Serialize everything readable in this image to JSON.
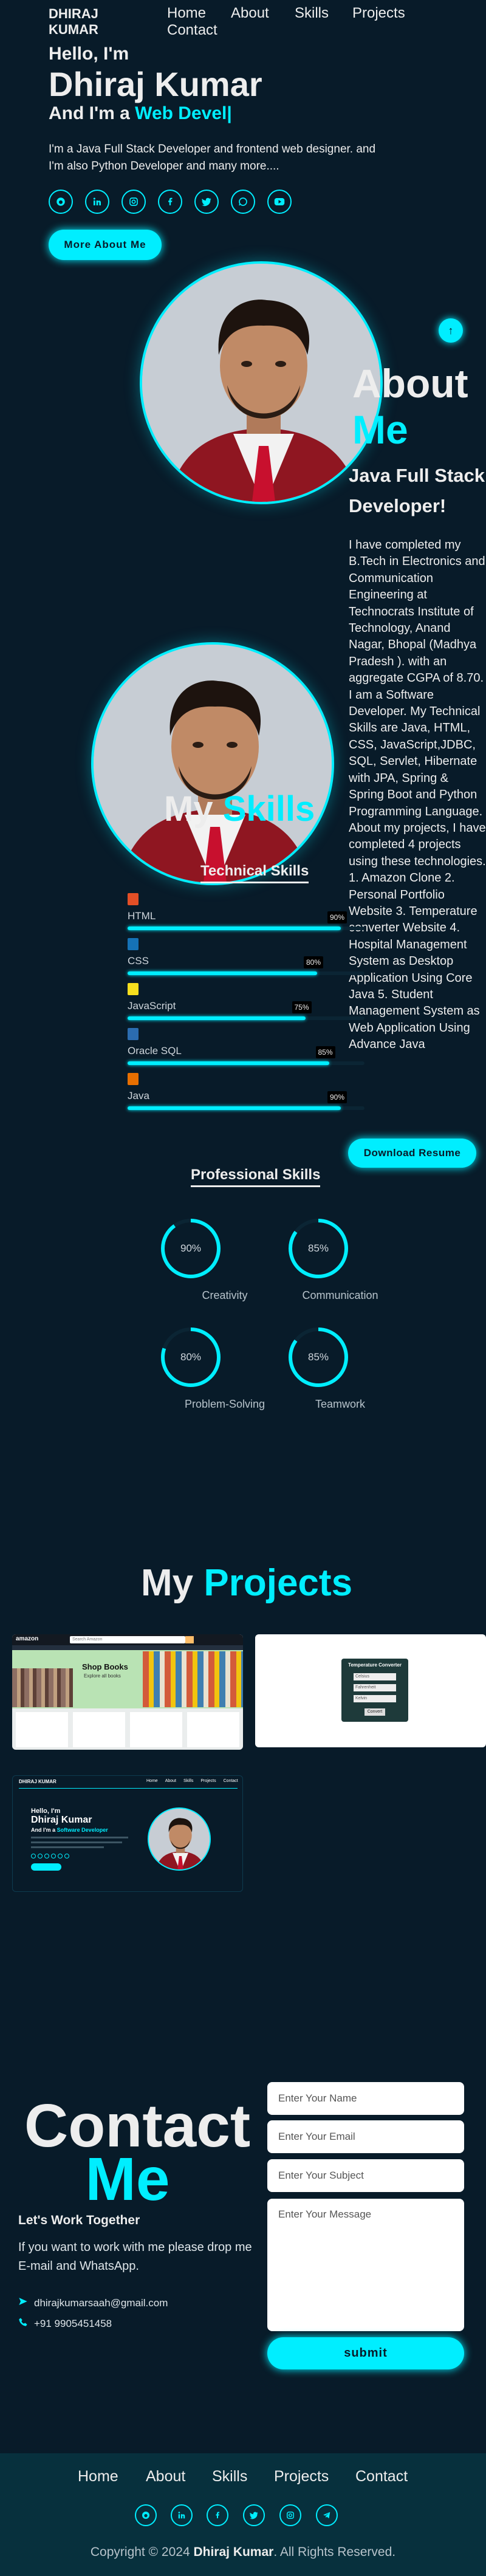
{
  "header": {
    "logo": "DHIRAJ KUMAR",
    "nav": [
      "Home",
      "About",
      "Skills",
      "Projects",
      "Contact"
    ]
  },
  "home": {
    "greeting": "Hello, I'm",
    "name": "Dhiraj Kumar",
    "iam_prefix": "And I'm a",
    "typed_role": "Web Devel|",
    "intro": "I'm a Java Full Stack Developer and frontend web designer. and I'm also Python Developer and many more....",
    "social_icons": [
      "github-icon",
      "linkedin-icon",
      "instagram-icon",
      "facebook-icon",
      "twitter-icon",
      "whatsapp-icon",
      "youtube-icon"
    ],
    "more_button": "More About Me",
    "scroll_top": "↑"
  },
  "about": {
    "title_1": "About",
    "title_2": "Me",
    "subtitle": "Java Full Stack Developer!",
    "text": "I have completed my B.Tech in Electronics and Communication Engineering at Technocrats Institute of Technology, Anand Nagar, Bhopal (Madhya Pradesh ). with an aggregate CGPA of 8.70. I am a Software Developer. My Technical Skills are Java, HTML, CSS, JavaScript,JDBC, SQL, Servlet, Hibernate with JPA, Spring & Spring Boot and Python Programming Language. About my projects, I have completed 4 projects using these technologies. 1. Amazon Clone 2. Personal Portfolio Website 3. Temperature converter Website 4. Hospital Management System as Desktop Application Using Core Java 5. Student Management System as Web Application Using Advance Java",
    "download_button": "Download Resume"
  },
  "skills": {
    "title_1": "My",
    "title_2": "Skills",
    "technical_title": "Technical Skills",
    "technical": [
      {
        "name": "HTML",
        "percent": 90,
        "label": "90%",
        "icon": "html5-icon",
        "color": "#e34f26"
      },
      {
        "name": "CSS",
        "percent": 80,
        "label": "80%",
        "icon": "css3-icon",
        "color": "#1572b6"
      },
      {
        "name": "JavaScript",
        "percent": 75,
        "label": "75%",
        "icon": "javascript-icon",
        "color": "#f7df1e"
      },
      {
        "name": "Oracle SQL",
        "percent": 85,
        "label": "85%",
        "icon": "database-icon",
        "color": "#2b6cb0"
      },
      {
        "name": "Java",
        "percent": 90,
        "label": "90%",
        "icon": "java-icon",
        "color": "#e76f00"
      }
    ],
    "professional_title": "Professional Skills",
    "professional": [
      {
        "name": "Creativity",
        "percent": 90,
        "label": "90%"
      },
      {
        "name": "Communication",
        "percent": 85,
        "label": "85%"
      },
      {
        "name": "Problem-Solving",
        "percent": 80,
        "label": "80%"
      },
      {
        "name": "Teamwork",
        "percent": 85,
        "label": "85%"
      }
    ]
  },
  "projects": {
    "title_1": "My",
    "title_2": "Projects",
    "amazon": {
      "logo": "amazon",
      "search_placeholder": "Search Amazon",
      "banner_title": "Shop Books",
      "banner_sub": "Explore all books"
    },
    "temperature": {
      "heading": "Temperature Converter",
      "fields": [
        "Celsius",
        "Fahrenheit",
        "Kelvin"
      ],
      "button": "Convert"
    },
    "portfolio": {
      "logo": "DHIRAJ KUMAR",
      "nav": [
        "Home",
        "About",
        "Skills",
        "Projects",
        "Contact"
      ],
      "greeting": "Hello, I'm",
      "name": "Dhiraj Kumar",
      "role_prefix": "And I'm a",
      "role": "Software Developer"
    }
  },
  "contact": {
    "title_1": "Contact",
    "title_2": "Me",
    "subtitle": "Let's Work Together",
    "text": "If you want to work with me please drop me E-mail and WhatsApp.",
    "email": "dhirajkumarsaah@gmail.com",
    "phone": "+91 9905451458",
    "form": {
      "name_placeholder": "Enter Your Name",
      "email_placeholder": "Enter Your Email",
      "subject_placeholder": "Enter Your Subject",
      "message_placeholder": "Enter Your Message",
      "submit": "submit"
    }
  },
  "footer": {
    "nav": [
      "Home",
      "About",
      "Skills",
      "Projects",
      "Contact"
    ],
    "social_icons": [
      "github-icon",
      "linkedin-icon",
      "facebook-icon",
      "twitter-icon",
      "instagram-icon",
      "telegram-icon"
    ],
    "copyright_prefix": "Copyright © 2024",
    "copyright_name": "Dhiraj Kumar",
    "copyright_suffix": ". All Rights Reserved."
  },
  "colors": {
    "background": "#081b29",
    "accent": "#00eeff",
    "text": "#ededed",
    "footer": "#07303d"
  }
}
